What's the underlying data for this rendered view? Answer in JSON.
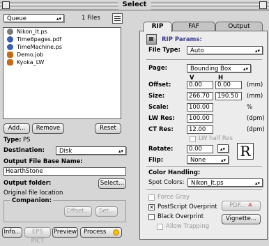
{
  "window": {
    "title": "Select"
  },
  "left": {
    "queue_select": "Queue",
    "files_count": "1 Files",
    "files": [
      {
        "name": "Nikon_It.ps",
        "color": "#7a7a7a"
      },
      {
        "name": "Time6pages.pdf",
        "color": "#3a5fb0"
      },
      {
        "name": "TimeMachine.ps",
        "color": "#3a5fb0"
      },
      {
        "name": "Demo.job",
        "color": "#c46a1a"
      },
      {
        "name": "Kyoka_LW",
        "color": "#c46a1a"
      }
    ],
    "add_label": "Add...",
    "remove_label": "Remove",
    "reset_label": "Reset",
    "type_label": "Type:",
    "type_value": "PS",
    "destination_label": "Destination:",
    "destination_value": "Disk",
    "output_base_label": "Output File Base Name:",
    "output_base_value": "HearthStone",
    "output_folder_label": "Output folder:",
    "select_label": "Select...",
    "original_location": "Original file location",
    "companion_label": "Companion:",
    "offset_label": "Offset...",
    "set_label": "Set...",
    "info_label": "Info...",
    "eps_pict_label": "EPS PICT",
    "preview_label": "Preview",
    "process_label": "Process"
  },
  "tabs": [
    "RIP",
    "FAF",
    "Output"
  ],
  "rip": {
    "params_title": "RIP Params:",
    "file_type_label": "File Type:",
    "file_type_value": "Auto",
    "page_label": "Page:",
    "page_value": "Bounding Box",
    "v_header": "V",
    "h_header": "H",
    "offset_label": "Offset:",
    "offset_v": "0.00",
    "offset_h": "0.00",
    "offset_unit": "(mm)",
    "size_label": "Size:",
    "size_v": "266.70",
    "size_h": "190.50",
    "size_unit": "(mm)",
    "scale_label": "Scale:",
    "scale_value": "100.00",
    "scale_unit": "%",
    "lw_res_label": "LW Res:",
    "lw_res_value": "100.00",
    "lw_res_unit": "(dpm)",
    "ct_res_label": "CT Res:",
    "ct_res_value": "12.00",
    "ct_res_unit": "(dpm)",
    "lw_half_res_label": "LW half Res",
    "rotate_label": "Rotate:",
    "rotate_value": "0.00",
    "flip_label": "Flip:",
    "flip_value": "None",
    "r_glyph": "R",
    "color_handling_label": "Color Handling:",
    "spot_colors_label": "Spot Colors:",
    "spot_colors_value": "Nikon_It.ps",
    "force_gray_label": "Force Gray",
    "ps_overprint_label": "PostScript Overprint",
    "black_overprint_label": "Black Overprint",
    "allow_trapping_label": "Allow Trapping",
    "pdf_label": "PDF...",
    "vignette_label": "Vignette..."
  }
}
